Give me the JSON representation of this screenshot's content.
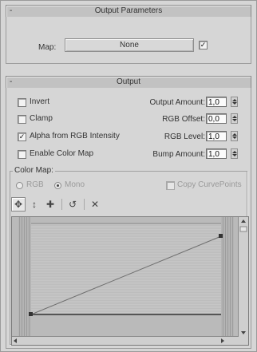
{
  "output_parameters": {
    "title": "Output Parameters",
    "collapse_glyph": "-",
    "map_label": "Map:",
    "map_button": "None",
    "map_enabled": true
  },
  "output": {
    "title": "Output",
    "collapse_glyph": "-",
    "checkboxes": [
      {
        "label": "Invert",
        "checked": false
      },
      {
        "label": "Clamp",
        "checked": false
      },
      {
        "label": "Alpha from RGB Intensity",
        "checked": true
      },
      {
        "label": "Enable Color Map",
        "checked": false
      }
    ],
    "spinners": [
      {
        "label": "Output Amount:",
        "value": "1,0"
      },
      {
        "label": "RGB Offset:",
        "value": "0,0"
      },
      {
        "label": "RGB Level:",
        "value": "1,0"
      },
      {
        "label": "Bump Amount:",
        "value": "1,0"
      }
    ]
  },
  "color_map": {
    "title": "Color Map:",
    "radios": [
      {
        "label": "RGB",
        "selected": false
      },
      {
        "label": "Mono",
        "selected": true
      }
    ],
    "copy_curve_points": {
      "label": "Copy CurvePoints",
      "checked": false
    },
    "toolbar": [
      {
        "name": "move-icon",
        "glyph": "✥"
      },
      {
        "name": "move-vertical-icon",
        "glyph": "↕"
      },
      {
        "name": "add-point-icon",
        "glyph": "✚"
      },
      {
        "name": "reset-curve-icon",
        "glyph": "↺"
      },
      {
        "name": "delete-point-icon",
        "glyph": "✕"
      }
    ]
  }
}
